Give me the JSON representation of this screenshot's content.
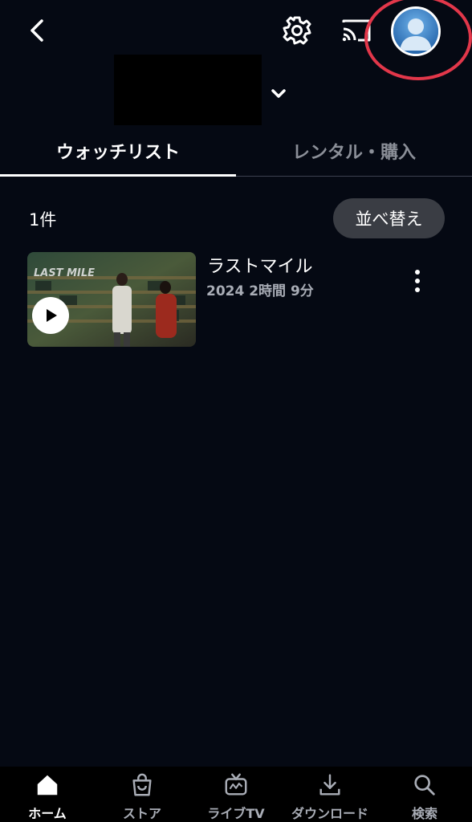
{
  "header": {
    "back_icon": "chevron-left-icon",
    "settings_icon": "gear-icon",
    "cast_icon": "cast-icon",
    "avatar_icon": "user-avatar-icon",
    "profile_chevron_icon": "chevron-down-icon"
  },
  "tabs": [
    {
      "label": "ウォッチリスト",
      "active": true
    },
    {
      "label": "レンタル・購入",
      "active": false
    }
  ],
  "list": {
    "count_label": "1件",
    "sort_label": "並べ替え"
  },
  "items": [
    {
      "title": "ラストマイル",
      "meta": "2024 2時間 9分"
    }
  ],
  "bottom_nav": [
    {
      "label": "ホーム",
      "icon": "home-icon",
      "active": true
    },
    {
      "label": "ストア",
      "icon": "shopping-bag-icon",
      "active": false
    },
    {
      "label": "ライブTV",
      "icon": "tv-icon",
      "active": false
    },
    {
      "label": "ダウンロード",
      "icon": "download-icon",
      "active": false
    },
    {
      "label": "検索",
      "icon": "search-icon",
      "active": false
    }
  ],
  "colors": {
    "background": "#050913",
    "highlight": "#e2374a",
    "inactive_text": "#8b8f98"
  }
}
